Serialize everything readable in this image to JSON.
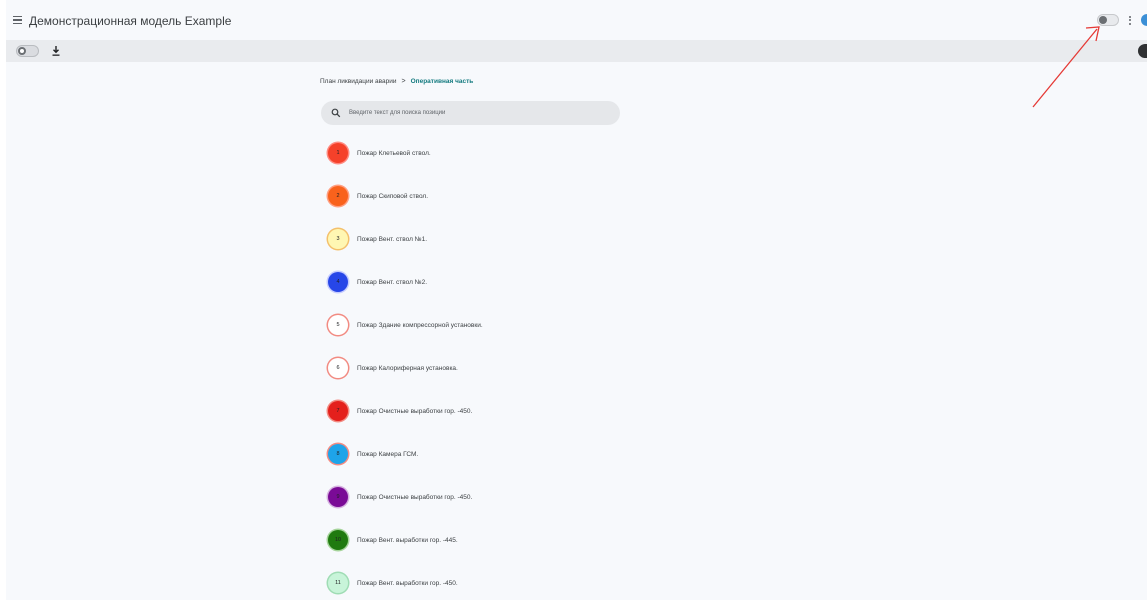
{
  "header": {
    "title": "Демонстрационная модель Example"
  },
  "breadcrumb": {
    "root": "План ликвидации аварии",
    "separator": ">",
    "current": "Оперативная часть"
  },
  "search": {
    "placeholder": "Введите текст для поиска позиции"
  },
  "items": [
    {
      "number": "1",
      "label": "Пожар Клетьевой ствол.",
      "fill": "#f5412a",
      "border": "#ff8a80"
    },
    {
      "number": "2",
      "label": "Пожар Скиповой ствол.",
      "fill": "#f9621c",
      "border": "#ff9e80"
    },
    {
      "number": "3",
      "label": "Пожар Вент. ствол №1.",
      "fill": "#fff7b3",
      "border": "#f4c06b"
    },
    {
      "number": "4",
      "label": "Пожар Вент. ствол №2.",
      "fill": "#2746e8",
      "border": "#c6ccff"
    },
    {
      "number": "5",
      "label": "Пожар Здание компрессорной установки.",
      "fill": "#ffffff",
      "border": "#f28b82"
    },
    {
      "number": "6",
      "label": "Пожар Калориферная установка.",
      "fill": "#ffffff",
      "border": "#f28b82"
    },
    {
      "number": "7",
      "label": "Пожар Очистные выработки гор. -450.",
      "fill": "#e4201c",
      "border": "#f28b82"
    },
    {
      "number": "8",
      "label": "Пожар Камера ГСМ.",
      "fill": "#1ea4e9",
      "border": "#f28b82"
    },
    {
      "number": "9",
      "label": "Пожар Очистные выработки гор. -450.",
      "fill": "#7a0b96",
      "border": "#d6b3e0"
    },
    {
      "number": "10",
      "label": "Пожар Вент. выработки гор. -445.",
      "fill": "#1f7a0f",
      "border": "#a5d49a"
    },
    {
      "number": "11",
      "label": "Пожар Вент. выработки гор. -450.",
      "fill": "#c8f4d9",
      "border": "#9fdcb4"
    }
  ],
  "icons": {
    "menu": "menu-icon",
    "theme_toggle": "toggle-icon",
    "more": "more-vert-icon",
    "download": "download-icon",
    "search": "search-icon"
  },
  "colors": {
    "accent": "#137a7f",
    "annotation": "#e53935"
  }
}
